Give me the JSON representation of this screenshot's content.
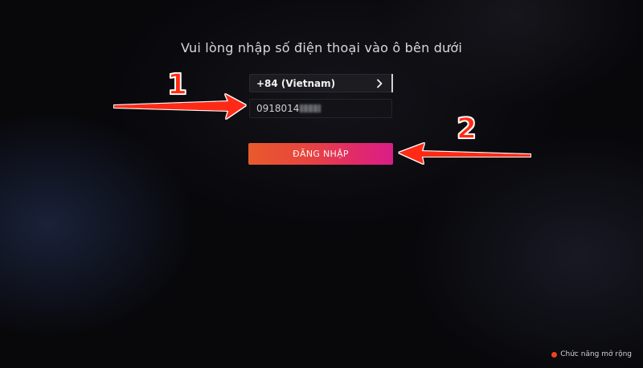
{
  "screen": {
    "heading": "Vui lòng nhập số điện thoại vào ô bên dưới"
  },
  "form": {
    "country_select": {
      "label": "+84 (Vietnam)",
      "icon": "chevron-right-icon"
    },
    "phone_input": {
      "value": "0918014"
    },
    "login_button": {
      "label": "ĐĂNG NHẬP",
      "colors": [
        "#e85a2c",
        "#d91e87"
      ]
    }
  },
  "annotations": {
    "step_1": "1",
    "step_2": "2",
    "arrow_color": "#ff2a12"
  },
  "footer": {
    "hint_label": "Chức năng mở rộng",
    "dot_color": "#f0421e"
  }
}
